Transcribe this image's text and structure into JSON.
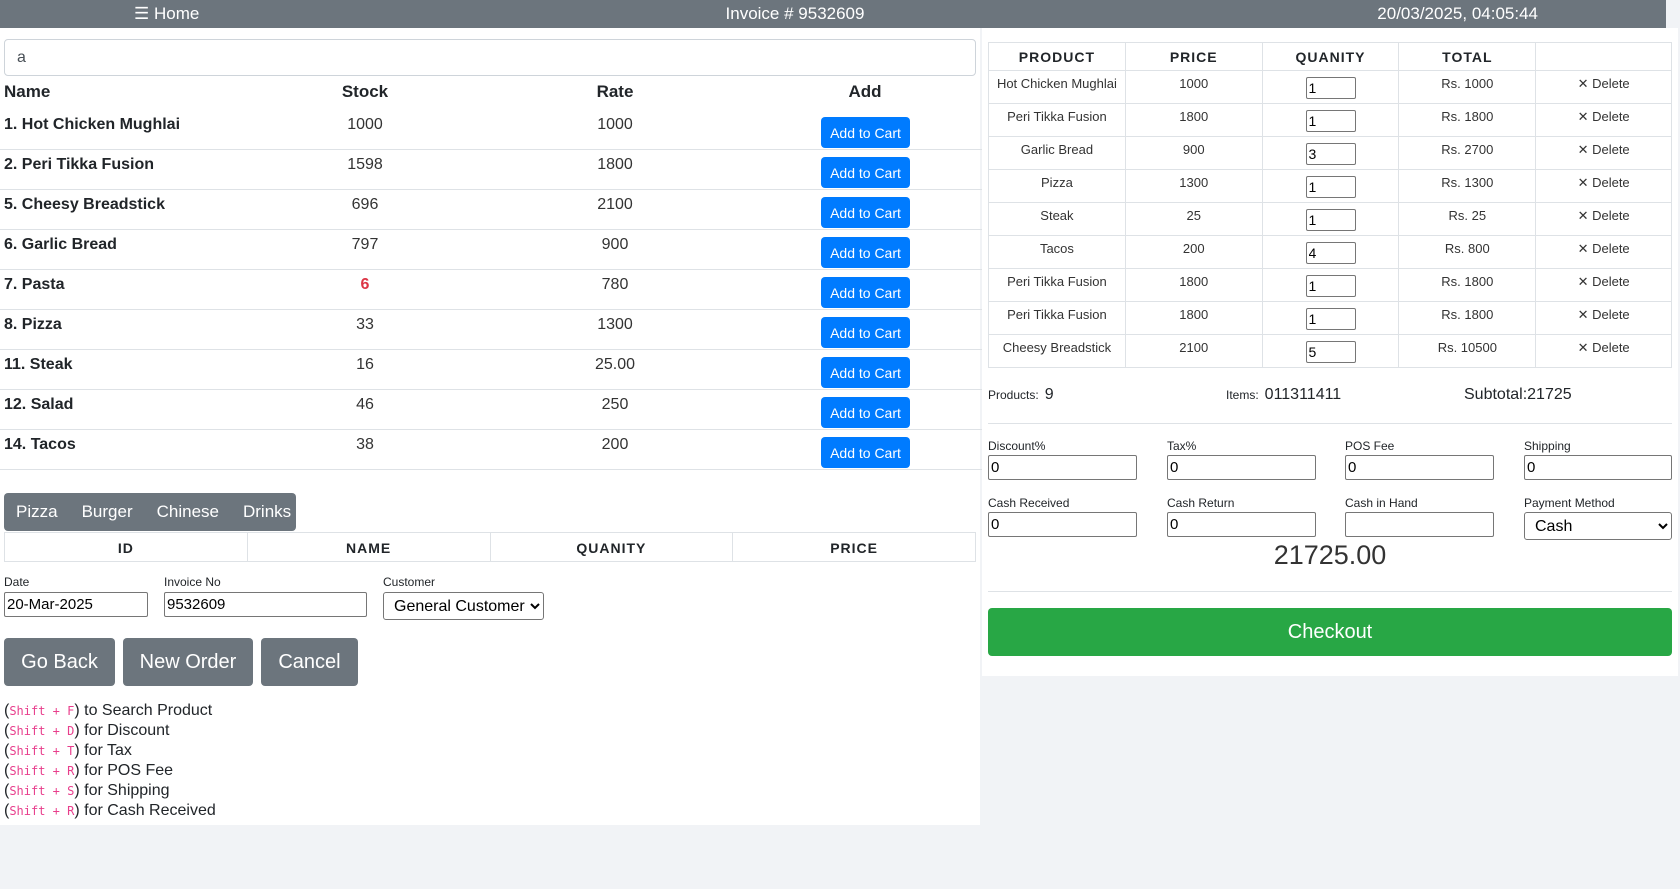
{
  "topbar": {
    "home": "☰ Home",
    "invoice": "Invoice # 9532609",
    "datetime": "20/03/2025, 04:05:44"
  },
  "search": {
    "value": "a"
  },
  "products": {
    "headers": {
      "name": "Name",
      "stock": "Stock",
      "rate": "Rate",
      "add": "Add"
    },
    "add_label": "Add to Cart",
    "rows": [
      {
        "name": "1. Hot Chicken Mughlai",
        "stock": "1000",
        "rate": "1000"
      },
      {
        "name": "2. Peri Tikka Fusion",
        "stock": "1598",
        "rate": "1800"
      },
      {
        "name": "5. Cheesy Breadstick",
        "stock": "696",
        "rate": "2100"
      },
      {
        "name": "6. Garlic Bread",
        "stock": "797",
        "rate": "900"
      },
      {
        "name": "7. Pasta",
        "stock": "6",
        "rate": "780"
      },
      {
        "name": "8. Pizza",
        "stock": "33",
        "rate": "1300"
      },
      {
        "name": "11. Steak",
        "stock": "16",
        "rate": "25.00"
      },
      {
        "name": "12. Salad",
        "stock": "46",
        "rate": "250"
      },
      {
        "name": "14. Tacos",
        "stock": "38",
        "rate": "200"
      }
    ]
  },
  "categories": [
    "Pizza",
    "Burger",
    "Chinese",
    "Drinks"
  ],
  "order_table": {
    "headers": [
      "ID",
      "NAME",
      "QUANITY",
      "PRICE"
    ]
  },
  "form": {
    "date_label": "Date",
    "date_value": "20-Mar-2025",
    "invoice_label": "Invoice No",
    "invoice_value": "9532609",
    "customer_label": "Customer",
    "customer_value": "General Customer"
  },
  "buttons": {
    "go_back": "Go Back",
    "new_order": "New Order",
    "cancel": "Cancel",
    "checkout": "Checkout"
  },
  "shortcuts": [
    {
      "key": "Shift + F",
      "text": ") to Search Product"
    },
    {
      "key": "Shift + D",
      "text": ") for Discount"
    },
    {
      "key": "Shift + T",
      "text": ") for Tax"
    },
    {
      "key": "Shift + R",
      "text": ") for POS Fee"
    },
    {
      "key": "Shift + S",
      "text": ") for Shipping"
    },
    {
      "key": "Shift + R",
      "text": ") for Cash Received"
    }
  ],
  "cart": {
    "headers": [
      "PRODUCT",
      "PRICE",
      "QUANITY",
      "TOTAL",
      ""
    ],
    "delete_label": "Delete",
    "rows": [
      {
        "product": "Hot Chicken Mughlai",
        "price": "1000",
        "qty": "1",
        "total": "Rs. 1000"
      },
      {
        "product": "Peri Tikka Fusion",
        "price": "1800",
        "qty": "1",
        "total": "Rs. 1800"
      },
      {
        "product": "Garlic Bread",
        "price": "900",
        "qty": "3",
        "total": "Rs. 2700"
      },
      {
        "product": "Pizza",
        "price": "1300",
        "qty": "1",
        "total": "Rs. 1300"
      },
      {
        "product": "Steak",
        "price": "25",
        "qty": "1",
        "total": "Rs. 25"
      },
      {
        "product": "Tacos",
        "price": "200",
        "qty": "4",
        "total": "Rs. 800"
      },
      {
        "product": "Peri Tikka Fusion",
        "price": "1800",
        "qty": "1",
        "total": "Rs. 1800"
      },
      {
        "product": "Peri Tikka Fusion",
        "price": "1800",
        "qty": "1",
        "total": "Rs. 1800"
      },
      {
        "product": "Cheesy Breadstick",
        "price": "2100",
        "qty": "5",
        "total": "Rs. 10500"
      }
    ]
  },
  "summary": {
    "products_label": "Products:",
    "products_value": "9",
    "items_label": "Items:",
    "items_value": "011311411",
    "subtotal_label": "Subtotal:",
    "subtotal_value": "21725"
  },
  "fees": {
    "discount_label": "Discount%",
    "discount_value": "0",
    "tax_label": "Tax%",
    "tax_value": "0",
    "pos_label": "POS Fee",
    "pos_value": "0",
    "shipping_label": "Shipping",
    "shipping_value": "0",
    "cash_received_label": "Cash Received",
    "cash_received_value": "0",
    "cash_return_label": "Cash Return",
    "cash_return_value": "0",
    "cash_hand_label": "Cash in Hand",
    "cash_hand_value": "",
    "payment_label": "Payment Method",
    "payment_value": "Cash"
  },
  "grand_total": "21725.00",
  "colors": {
    "topbar": "#6c757d",
    "primary": "#007bff",
    "success": "#28a745",
    "danger": "#dc3545"
  }
}
